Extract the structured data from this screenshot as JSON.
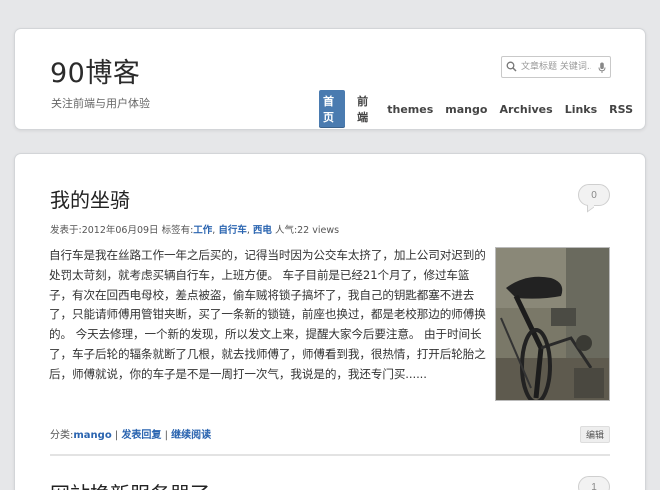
{
  "site": {
    "title": "90博客",
    "description": "关注前端与用户体验"
  },
  "search": {
    "placeholder": "文章标题 关键词..."
  },
  "nav": {
    "items": [
      "首页",
      "前端",
      "themes",
      "mango",
      "Archives",
      "Links",
      "RSS"
    ],
    "active_index": 0
  },
  "colors": {
    "accent": "#4a7bb0",
    "link": "#2a64b0"
  },
  "post": {
    "title": "我的坐骑",
    "comments": "0",
    "meta_prefix": "发表于:2012年06月09日 标签有:",
    "tags": [
      "工作",
      "自行车",
      "西电"
    ],
    "views_label": " 人气:22 views",
    "excerpt": "自行车是我在丝路工作一年之后买的，记得当时因为公交车太挤了，加上公司对迟到的处罚太苛刻，就考虑买辆自行车，上班方便。 车子目前是已经21个月了，修过车篮子，有次在回西电母校，差点被盗，偷车贼将锁子搞坏了，我自己的钥匙都塞不进去了，只能请师傅用管钳夹断，买了一条新的锁链，前座也换过，都是老校那边的师傅换的。 今天去修理，一个新的发现，所以发文上来，提醒大家今后要注意。 由于时间长了，车子后轮的辐条就断了几根，就去找师傅了，师傅看到我，很热情，打开后轮胎之后，师傅就说，你的车子是不是一周打一次气，我说是的，我还专门买......",
    "category_label": "分类:",
    "category": "mango",
    "reply_label": "发表回复",
    "readmore_label": "继续阅读",
    "edit_label": "编辑",
    "thumbnail_icon": "bicycle-photo"
  },
  "next_post": {
    "title": "网站换新服务器了",
    "comments": "1"
  }
}
